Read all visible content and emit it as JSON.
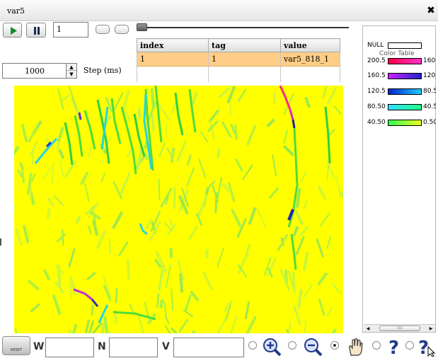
{
  "window": {
    "title": "var5",
    "close_glyph": "✖"
  },
  "controls": {
    "play_icon": "play-icon",
    "pause_icon": "pause-icon",
    "step_value": "1",
    "delay_value": "1000",
    "delay_label": "Step (ms)"
  },
  "table": {
    "headers": [
      "index",
      "tag",
      "value"
    ],
    "rows": [
      [
        "1",
        "1",
        "var5_818_1"
      ]
    ]
  },
  "legend": {
    "title": "Color Table",
    "items": [
      {
        "low": "NULL",
        "high": "",
        "color": "#ffffff"
      },
      {
        "low": "200.5",
        "high": "160",
        "color": "#ff0044",
        "color2": "#ff33cc"
      },
      {
        "low": "160.5",
        "high": "120",
        "color": "#cc22ff",
        "color2": "#2222cc"
      },
      {
        "low": "120.5",
        "high": "80.5",
        "color": "#0022cc",
        "color2": "#22ccff"
      },
      {
        "low": "80.50",
        "high": "40.5",
        "color": "#33ddff",
        "color2": "#22ff88"
      },
      {
        "low": "40.50",
        "high": "0.50",
        "color": "#33ff55",
        "color2": "#eeff22"
      }
    ],
    "scroll_grip": "IIII"
  },
  "bottom": {
    "reset_label": "RESET",
    "w_label": "W",
    "n_label": "N",
    "v_label": "V",
    "tools": [
      "zoom-in-icon",
      "zoom-out-icon",
      "hand-pan-icon",
      "help-icon",
      "help-cursor-icon"
    ],
    "selected_tool": "hand-pan-icon"
  },
  "colors": {
    "map_background": "#ffff00",
    "selected_row": "#ffcd86"
  }
}
